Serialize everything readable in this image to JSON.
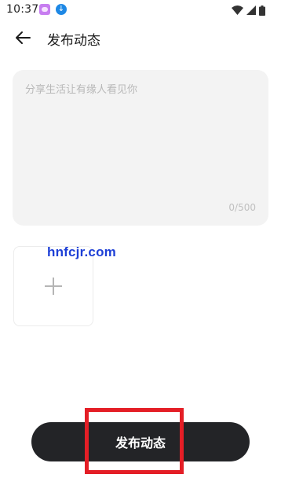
{
  "status_bar": {
    "time": "10:37"
  },
  "header": {
    "title": "发布动态"
  },
  "post": {
    "placeholder": "分享生活让有缘人看见你",
    "value": "",
    "counter": "0/500"
  },
  "watermark": "hnfcjr.com",
  "publish_button": {
    "label": "发布动态"
  },
  "colors": {
    "button_bg": "#232427",
    "card_bg": "#f3f3f3",
    "highlight": "#e41e26",
    "watermark": "#1d3fd6"
  }
}
